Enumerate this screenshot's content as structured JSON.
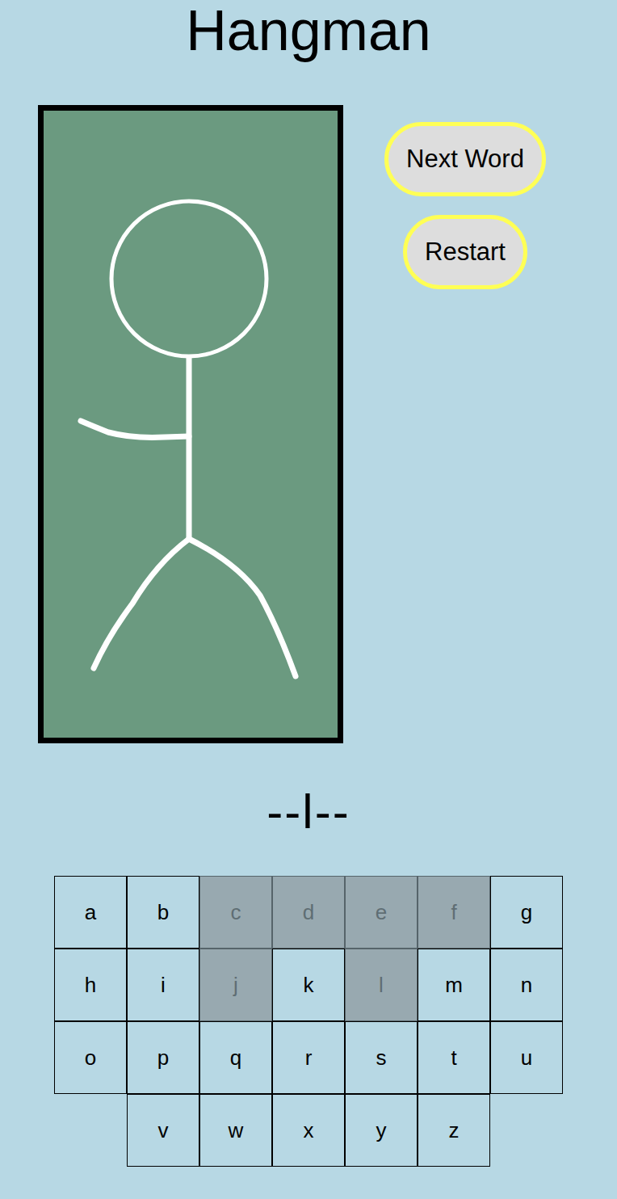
{
  "title": "Hangman",
  "buttons": [
    {
      "label": "Next Word"
    },
    {
      "label": "Restart"
    }
  ],
  "figure": [
    {
      "kind": "head",
      "shown": true
    },
    {
      "kind": "body",
      "shown": true
    },
    {
      "kind": "left-arm",
      "shown": true
    },
    {
      "kind": "right-arm",
      "shown": false
    },
    {
      "kind": "left-leg",
      "shown": true
    },
    {
      "kind": "right-leg",
      "shown": true
    }
  ],
  "word": "--l--",
  "keyboard": [
    [
      {
        "letter": "a",
        "used": false
      },
      {
        "letter": "b",
        "used": false
      },
      {
        "letter": "c",
        "used": true
      },
      {
        "letter": "d",
        "used": true
      },
      {
        "letter": "e",
        "used": true
      },
      {
        "letter": "f",
        "used": true
      },
      {
        "letter": "g",
        "used": false
      }
    ],
    [
      {
        "letter": "h",
        "used": false
      },
      {
        "letter": "i",
        "used": false
      },
      {
        "letter": "j",
        "used": true
      },
      {
        "letter": "k",
        "used": false
      },
      {
        "letter": "l",
        "used": true
      },
      {
        "letter": "m",
        "used": false
      },
      {
        "letter": "n",
        "used": false
      }
    ],
    [
      {
        "letter": "o",
        "used": false
      },
      {
        "letter": "p",
        "used": false
      },
      {
        "letter": "q",
        "used": false
      },
      {
        "letter": "r",
        "used": false
      },
      {
        "letter": "s",
        "used": false
      },
      {
        "letter": "t",
        "used": false
      },
      {
        "letter": "u",
        "used": false
      }
    ],
    [
      {
        "letter": "v",
        "used": false
      },
      {
        "letter": "w",
        "used": false
      },
      {
        "letter": "x",
        "used": false
      },
      {
        "letter": "y",
        "used": false
      },
      {
        "letter": "z",
        "used": false
      }
    ]
  ]
}
